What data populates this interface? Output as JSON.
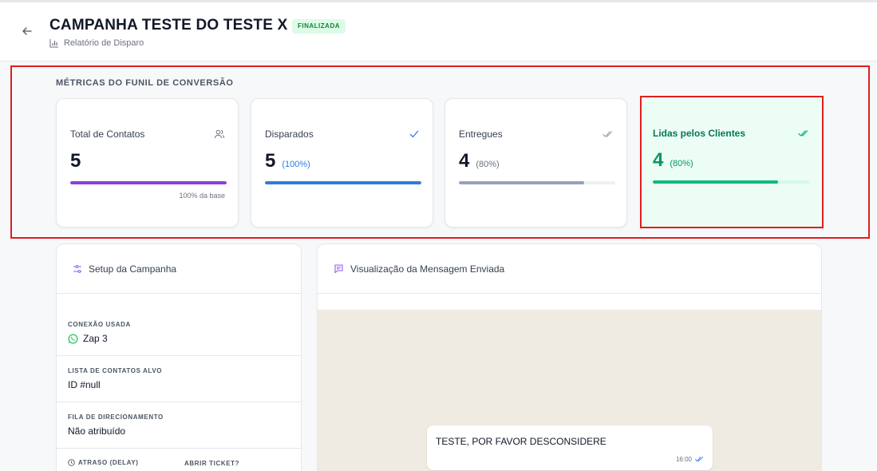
{
  "header": {
    "title": "CAMPANHA TESTE DO TESTE X",
    "status_badge": "FINALIZADA",
    "subtitle": "Relatório de Disparo"
  },
  "funnel": {
    "section_title": "MÉTRICAS DO FUNIL DE CONVERSÃO",
    "cards": [
      {
        "label": "Total de Contatos",
        "value": "5",
        "percent_text": "",
        "progress": 1.0,
        "footnote": "100% da base",
        "icon": "users-icon",
        "color": "#8b3fd9"
      },
      {
        "label": "Disparados",
        "value": "5",
        "percent_text": "(100%)",
        "progress": 1.0,
        "footnote": "",
        "icon": "check-icon",
        "color": "#2f7de1"
      },
      {
        "label": "Entregues",
        "value": "4",
        "percent_text": "(80%)",
        "progress": 0.8,
        "footnote": "",
        "icon": "double-check-icon",
        "color": "#94a3b8"
      },
      {
        "label": "Lidas pelos Clientes",
        "value": "4",
        "percent_text": "(80%)",
        "progress": 0.8,
        "footnote": "",
        "icon": "double-check-icon",
        "color": "#10b981"
      }
    ]
  },
  "setup": {
    "title": "Setup da Campanha",
    "connection_label": "CONEXÃO USADA",
    "connection_value": "Zap 3",
    "contact_list_label": "LISTA DE CONTATOS ALVO",
    "contact_list_value": "ID #null",
    "queue_label": "FILA DE DIRECIONAMENTO",
    "queue_value": "Não atribuído",
    "delay_label": "ATRASO (DELAY)",
    "open_ticket_label": "ABRIR TICKET?"
  },
  "preview": {
    "title": "Visualização da Mensagem Enviada",
    "message": "TESTE, POR FAVOR DESCONSIDERE",
    "time": "16:00"
  },
  "colors": {
    "highlight_border": "#e11d1d",
    "badge_bg": "#dcfce7",
    "badge_text": "#15803d",
    "read_bg": "#ecfdf5",
    "chat_bg": "#efeae2"
  }
}
